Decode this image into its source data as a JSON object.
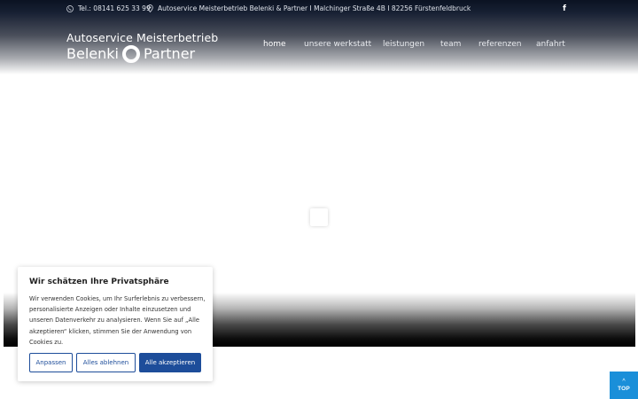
{
  "topbar": {
    "phone": "Tel.: 08141 625 33 99",
    "address": "Autoservice Meisterbetrieb Belenki & Partner I Malchinger Straße 4B I 82256 Fürstenfeldbruck",
    "facebook_glyph": "f"
  },
  "logo": {
    "line1": "Autoservice Meisterbetrieb",
    "line2_left": "Belenki",
    "line2_right": "Partner"
  },
  "nav": {
    "home": "home",
    "werkstatt": "unsere werkstatt",
    "leistungen": "leistungen",
    "team": "team",
    "referenzen": "referenzen",
    "anfahrt": "anfahrt"
  },
  "cookie": {
    "title": "Wir schätzen Ihre Privatsphäre",
    "text": "Wir verwenden Cookies, um Ihr Surferlebnis zu verbessern, personalisierte Anzeigen oder Inhalte einzusetzen und unseren Datenverkehr zu analysieren. Wenn Sie auf „Alle akzeptieren“ klicken, stimmen Sie der Anwendung von Cookies zu.",
    "customize": "Anpassen",
    "reject": "Alles ablehnen",
    "accept": "Alle akzeptieren"
  },
  "totop": {
    "chevron": "^",
    "label": "TOP"
  },
  "colors": {
    "accent": "#1d4d9a",
    "totop": "#1a8fd9",
    "header_dark": "#0b1222"
  }
}
